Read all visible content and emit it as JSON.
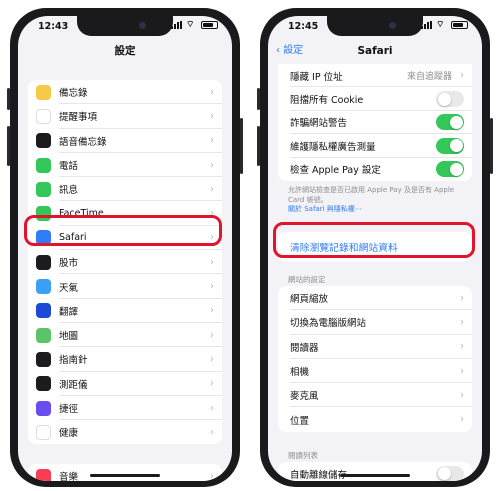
{
  "left_phone": {
    "status_time": "12:43",
    "title": "設定",
    "items": [
      {
        "label": "備忘錄",
        "icon": "notes-icon",
        "color": "#f7c948"
      },
      {
        "label": "提醒事項",
        "icon": "reminders-icon",
        "color": "#ffffff"
      },
      {
        "label": "語音備忘錄",
        "icon": "voice-memos-icon",
        "color": "#1c1c1e"
      },
      {
        "label": "電話",
        "icon": "phone-icon",
        "color": "#34c759"
      },
      {
        "label": "訊息",
        "icon": "messages-icon",
        "color": "#34c759"
      },
      {
        "label": "FaceTime",
        "icon": "facetime-icon",
        "color": "#34c759"
      },
      {
        "label": "Safari",
        "icon": "safari-icon",
        "color": "#2f7cf6"
      },
      {
        "label": "股市",
        "icon": "stocks-icon",
        "color": "#1c1c1e"
      },
      {
        "label": "天氣",
        "icon": "weather-icon",
        "color": "#3aa0f2"
      },
      {
        "label": "翻譯",
        "icon": "translate-icon",
        "color": "#1c4ad6"
      },
      {
        "label": "地圖",
        "icon": "maps-icon",
        "color": "#5ac466"
      },
      {
        "label": "指南針",
        "icon": "compass-icon",
        "color": "#1c1c1e"
      },
      {
        "label": "測距儀",
        "icon": "measure-icon",
        "color": "#1c1c1e"
      },
      {
        "label": "捷徑",
        "icon": "shortcuts-icon",
        "color": "#6a4cf0"
      },
      {
        "label": "健康",
        "icon": "health-icon",
        "color": "#ffffff"
      }
    ],
    "bottom_item": {
      "label": "音樂",
      "icon": "music-icon",
      "color": "#fa3c55"
    }
  },
  "right_phone": {
    "status_time": "12:45",
    "back_label": "設定",
    "title": "Safari",
    "rows": [
      {
        "label": "隱藏 IP 位址",
        "type": "value",
        "value": "來自追蹤器"
      },
      {
        "label": "阻擋所有 Cookie",
        "type": "toggle",
        "on": false
      },
      {
        "label": "詐騙網站警告",
        "type": "toggle",
        "on": true
      },
      {
        "label": "維護隱私權廣告測量",
        "type": "toggle",
        "on": true
      },
      {
        "label": "檢查 Apple Pay 設定",
        "type": "toggle",
        "on": true
      }
    ],
    "note_text": "允許網站檢查是否已啟用 Apple Pay 及是否有 Apple Card 帳號。",
    "note_link": "關於 Safari 與隱私權⋯",
    "clear_action": "清除瀏覽記錄和網站資料",
    "section_website_settings": "網站的設定",
    "website_rows": [
      "網頁縮放",
      "切換為電腦版網站",
      "閱讀器",
      "相機",
      "麥克風",
      "位置"
    ],
    "section_reading_list": "閱讀列表",
    "reading_row": "自動離線儲存"
  }
}
